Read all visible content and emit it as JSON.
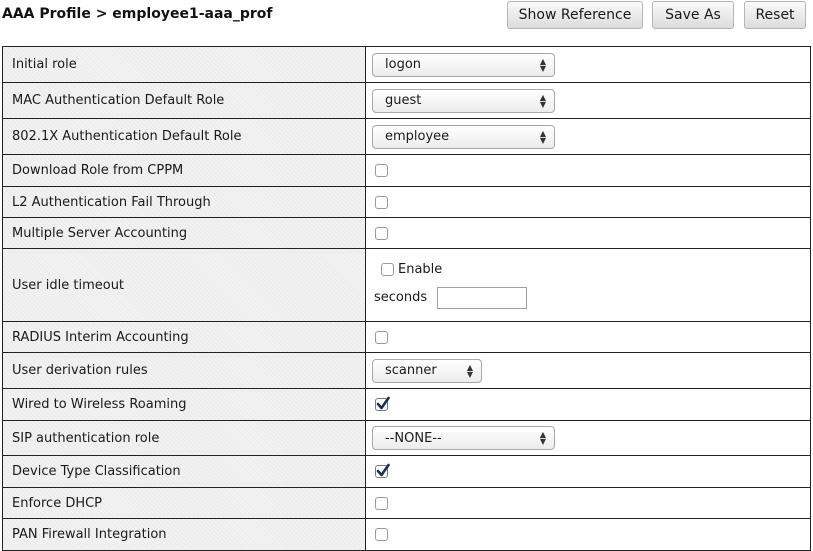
{
  "header": {
    "title": "AAA Profile > employee1-aaa_prof",
    "buttons": {
      "show_reference": "Show Reference",
      "save_as": "Save As",
      "reset": "Reset"
    }
  },
  "rows": {
    "initial_role": {
      "label": "Initial role",
      "value": "logon"
    },
    "mac_auth_default_role": {
      "label": "MAC Authentication Default Role",
      "value": "guest"
    },
    "dot1x_auth_default_role": {
      "label": "802.1X Authentication Default Role",
      "value": "employee"
    },
    "download_role_cppm": {
      "label": "Download Role from CPPM",
      "checked": false
    },
    "l2_auth_fail_through": {
      "label": "L2 Authentication Fail Through",
      "checked": false
    },
    "multiple_server_accounting": {
      "label": "Multiple Server Accounting",
      "checked": false
    },
    "user_idle_timeout": {
      "label": "User idle timeout",
      "enable_label": "Enable",
      "enable_checked": false,
      "seconds_label": "seconds",
      "seconds_value": ""
    },
    "radius_interim_accounting": {
      "label": "RADIUS Interim Accounting",
      "checked": false
    },
    "user_derivation_rules": {
      "label": "User derivation rules",
      "value": "scanner"
    },
    "wired_to_wireless_roaming": {
      "label": "Wired to Wireless Roaming",
      "checked": true
    },
    "sip_auth_role": {
      "label": "SIP authentication role",
      "value": "--NONE--"
    },
    "device_type_classification": {
      "label": "Device Type Classification",
      "checked": true
    },
    "enforce_dhcp": {
      "label": "Enforce DHCP",
      "checked": false
    },
    "pan_firewall_integration": {
      "label": "PAN Firewall Integration",
      "checked": false
    }
  },
  "colors": {
    "label_bg": "#f2f2f2",
    "border": "#222222",
    "checkmark": "#1b2f56"
  }
}
